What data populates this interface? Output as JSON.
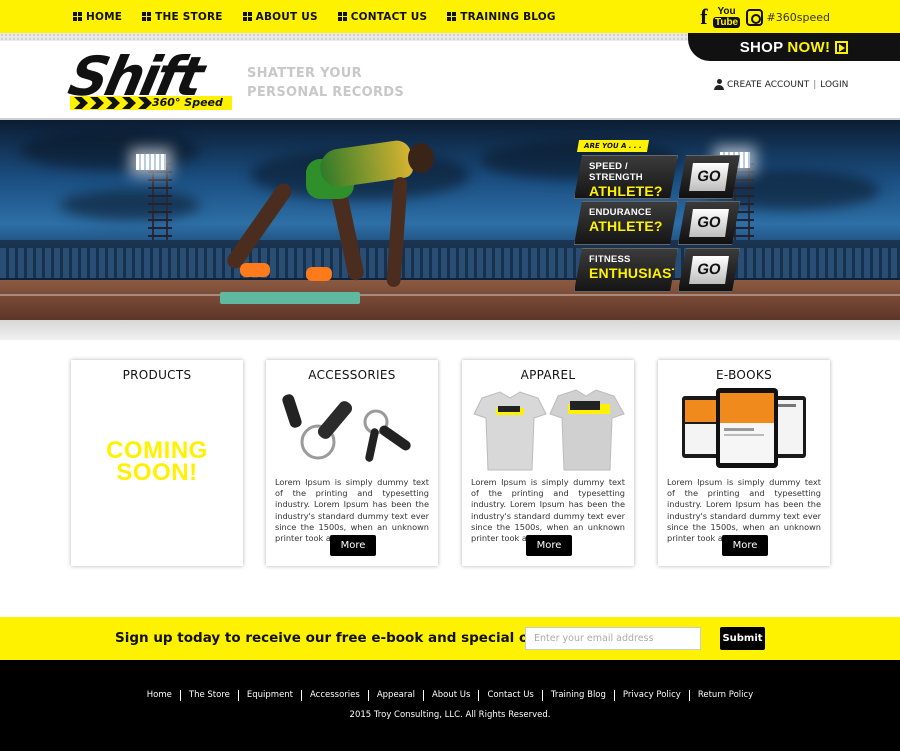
{
  "topnav": {
    "items": [
      {
        "label": "HOME"
      },
      {
        "label": "THE STORE"
      },
      {
        "label": "ABOUT US"
      },
      {
        "label": "CONTACT US"
      },
      {
        "label": "TRAINING BLOG"
      }
    ],
    "social": {
      "facebook": "f",
      "youtube_top": "You",
      "youtube_bottom": "Tube",
      "hashtag": "#360speed"
    }
  },
  "header": {
    "shop_now": "SHOP",
    "shop_now_accent": "NOW!",
    "logo_word": "Shift",
    "logo_sub": "360° Speed",
    "tagline_line1": "SHATTER YOUR",
    "tagline_line2": "PERSONAL RECORDS",
    "create_account": "CREATE ACCOUNT",
    "separator": "|",
    "login": "LOGIN"
  },
  "hero": {
    "are_you": "ARE YOU A . . .",
    "ctas": [
      {
        "line1": "SPEED / STRENGTH",
        "line2": "ATHLETE?",
        "go": "GO"
      },
      {
        "line1": "ENDURANCE",
        "line2": "ATHLETE?",
        "go": "GO"
      },
      {
        "line1": "FITNESS",
        "line2": "ENTHUSIAST?",
        "go": "GO"
      }
    ]
  },
  "products": [
    {
      "title": "PRODUCTS",
      "coming_soon_1": "COMING",
      "coming_soon_2": "SOON!"
    },
    {
      "title": "ACCESSORIES",
      "desc": "Lorem Ipsum is simply dummy text of the printing and typesetting industry. Lorem Ipsum has been the industry's standard dummy text ever since the 1500s, when an unknown printer took a galley.",
      "button": "More"
    },
    {
      "title": "APPAREL",
      "desc": "Lorem Ipsum is simply dummy text of the printing and typesetting industry. Lorem Ipsum has been the industry's standard dummy text ever since the 1500s, when an unknown printer took a galley.",
      "button": "More"
    },
    {
      "title": "E-BOOKS",
      "desc": "Lorem Ipsum is simply dummy text of the printing and typesetting industry. Lorem Ipsum has been the industry's standard dummy text ever since the 1500s, when an unknown printer took a galley.",
      "button": "More"
    }
  ],
  "signup": {
    "text": "Sign up today to receive our free e-book and special offers!",
    "placeholder": "Enter your email address",
    "button": "Submit"
  },
  "footer": {
    "links": [
      "Home",
      "The Store",
      "Equipment",
      "Accessories",
      "Appearal",
      "About Us",
      "Contact Us",
      "Training Blog",
      "Privacy Policy",
      "Return Policy"
    ],
    "copyright": "2015 Troy Consulting, LLC. All Rights Reserved."
  },
  "colors": {
    "accent": "#fff200",
    "dark": "#000000"
  },
  "icons": [
    "grid-icon",
    "facebook-icon",
    "youtube-icon",
    "instagram-icon",
    "user-icon",
    "play-icon"
  ]
}
